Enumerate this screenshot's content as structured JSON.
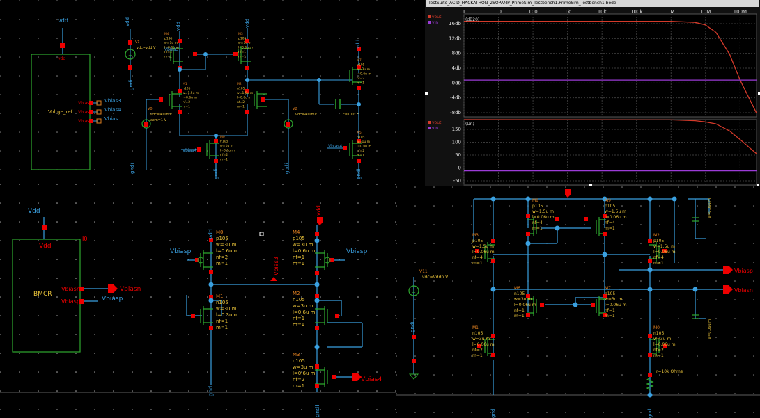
{
  "waveform": {
    "title": "TestSuite_ACID_HACKATHON_2SOPAMP_PrimeSim_Testbench1.PrimeSim_Testbench1.bode",
    "x_ticks": [
      "1",
      "10",
      "100",
      "1k",
      "10k",
      "100k",
      "1M",
      "10M",
      "100M"
    ],
    "mag_unit": "(dB20)",
    "mag_ticks": [
      "16db",
      "12db",
      "8db",
      "4db",
      "0db",
      "-4db",
      "-8db"
    ],
    "phase_unit": "(Un)",
    "phase_ticks": [
      "150",
      "100",
      "50",
      "0",
      "-50"
    ],
    "legend_mag": [
      "vout",
      "vin"
    ],
    "legend_phase": [
      "vout",
      "vin"
    ]
  },
  "chart_data": [
    {
      "type": "line",
      "title": "",
      "xlabel": "",
      "ylabel": "dB20",
      "x_scale": "log",
      "xlim": [
        1,
        300000000
      ],
      "ylim": [
        -10,
        18
      ],
      "series": [
        {
          "x": [
            1,
            1000000,
            5000000,
            10000000,
            20000000,
            50000000,
            100000000,
            300000000
          ],
          "y": [
            16,
            16,
            15.7,
            15,
            13,
            7,
            0,
            -9
          ]
        },
        {
          "x": [
            1,
            300000000
          ],
          "y": [
            0,
            0
          ]
        }
      ]
    },
    {
      "type": "line",
      "title": "",
      "xlabel": "",
      "ylabel": "Un",
      "x_scale": "log",
      "xlim": [
        1,
        300000000
      ],
      "ylim": [
        -50,
        180
      ],
      "series": [
        {
          "x": [
            1,
            1000000,
            5000000,
            10000000,
            20000000,
            50000000,
            100000000,
            300000000
          ],
          "y": [
            180,
            179,
            176,
            172,
            165,
            140,
            110,
            60
          ]
        },
        {
          "x": [
            1,
            300000000
          ],
          "y": [
            0,
            0
          ]
        }
      ]
    }
  ],
  "opamp": {
    "vdd": "vdd",
    "gnd": "gndi",
    "block_label": "Voltge_ref",
    "block_pin": "vdd",
    "ports": [
      "Vbias3",
      "Vbias4",
      "Vbias"
    ],
    "v1": "V1",
    "v1_val": "vdc=vdd V",
    "v0": "V0",
    "v0_val": "vdc=400mV",
    "v0_acm": "acm=1 V",
    "v2": "V2",
    "v2_val": "vdc=400mV",
    "cap": "c=100f F",
    "mos": [
      {
        "n": "M4",
        "p": "p105",
        "w": "w=1u m",
        "l": "l=0.6u m",
        "nf": "nf=2",
        "m": "m=1"
      },
      {
        "n": "M3",
        "p": "p105",
        "w": "w=1u m",
        "l": "l=0.6u m",
        "nf": "nf=1",
        "m": "m=1"
      },
      {
        "n": "M1",
        "p": "n105",
        "w": "w=1.5u m",
        "l": "l=0.6u m",
        "nf": "nf=2",
        "m": "m=1"
      },
      {
        "n": "M2",
        "p": "n105",
        "w": "w=1.5u m",
        "l": "l=0.6u m",
        "nf": "nf=2",
        "m": "m=1"
      },
      {
        "n": "M0",
        "p": "n105",
        "w": "w=1u m",
        "l": "l=0.6u m",
        "nf": "nf=2",
        "m": "m=1"
      },
      {
        "n": "M7",
        "p": "p105",
        "w": "w=3u m",
        "l": "l=0.6u m",
        "nf": "nf=2",
        "m": "m=1"
      },
      {
        "n": "M5",
        "p": "n105",
        "w": "w=1u m",
        "l": "l=0.6u m",
        "nf": "nf=2",
        "m": "m=1"
      }
    ]
  },
  "bmcr": {
    "vdd": "Vdd",
    "block_label": "BMCR",
    "block_id": "I0",
    "port_n": "Vbiasn",
    "port_p": "Vbiasp",
    "wire_p": "Vbiasp",
    "out_n": "Vbiasn",
    "vbias3": "Vbias3",
    "vbias4": "Vbias4",
    "gnd": "gndi",
    "vdd_pin": "vdd",
    "m0": {
      "n": "M0",
      "p": "p105",
      "w": "w=3u m",
      "l": "l=0.6u m",
      "nf": "nf=2",
      "m": "m=1"
    },
    "m1": {
      "n": "M1",
      "p": "n105",
      "w": "w=3u m",
      "l": "l=0.3u m",
      "nf": "nf=1",
      "m": "m=1"
    },
    "m4": {
      "n": "M4",
      "p": "p105",
      "w": "w=3u m",
      "l": "l=0.6u m",
      "nf": "nf=1",
      "m": "m=1"
    },
    "m2": {
      "n": "M2",
      "p": "n105",
      "w": "w=3u m",
      "l": "l=0.6u m",
      "nf": "nf=1",
      "m": "m=1"
    },
    "m3": {
      "n": "M3",
      "p": "n105",
      "w": "w=3u m",
      "l": "l=0.6u m",
      "nf": "nf=2",
      "m": "m=1"
    }
  },
  "ref": {
    "v11": "V11",
    "v11_val": "vdc=Vddn V",
    "gnd": "gndi",
    "vbiasp": "Vbiasp",
    "vbiasn": "Vbiasn",
    "r": "r=10k Ohms",
    "m8": {
      "n": "M8",
      "p": "p105",
      "w": "w=1.5u m",
      "l": "l=0.06u m",
      "nf": "nf=4",
      "m": "m=1"
    },
    "m9": {
      "n": "M9",
      "p": "p105",
      "w": "w=1.5u m",
      "l": "l=0.06u m",
      "nf": "nf=4",
      "m": "m=1"
    },
    "m3": {
      "n": "M3",
      "p": "p105",
      "w": "w=1.5u m",
      "l": "l=0.06u m",
      "nf": "nf=4",
      "m": "m=1"
    },
    "m2": {
      "n": "M2",
      "p": "p105",
      "w": "w=1.5u m",
      "l": "l=0.06u m",
      "nf": "nf=4",
      "m": "m=1"
    },
    "m6": {
      "n": "M6",
      "p": "n105",
      "w": "w=3u m",
      "l": "l=0.06u m",
      "nf": "nf=1",
      "m": "m=1"
    },
    "m7": {
      "n": "M7",
      "p": "n105",
      "w": "w=3u m",
      "l": "l=0.06u m",
      "nf": "nf=1",
      "m": "m=1"
    },
    "m1": {
      "n": "M1",
      "p": "n105",
      "w": "w=3u m",
      "l": "l=0.06u m",
      "nf": "nf=2",
      "m": "m=1"
    },
    "m0": {
      "n": "M0",
      "p": "n105",
      "w": "w=3u m",
      "l": "l=0.06u m",
      "nf": "nf=2",
      "m": "m=1"
    },
    "cap_top": "w=0.06u m",
    "cap_bot": "w=0.06u m"
  }
}
